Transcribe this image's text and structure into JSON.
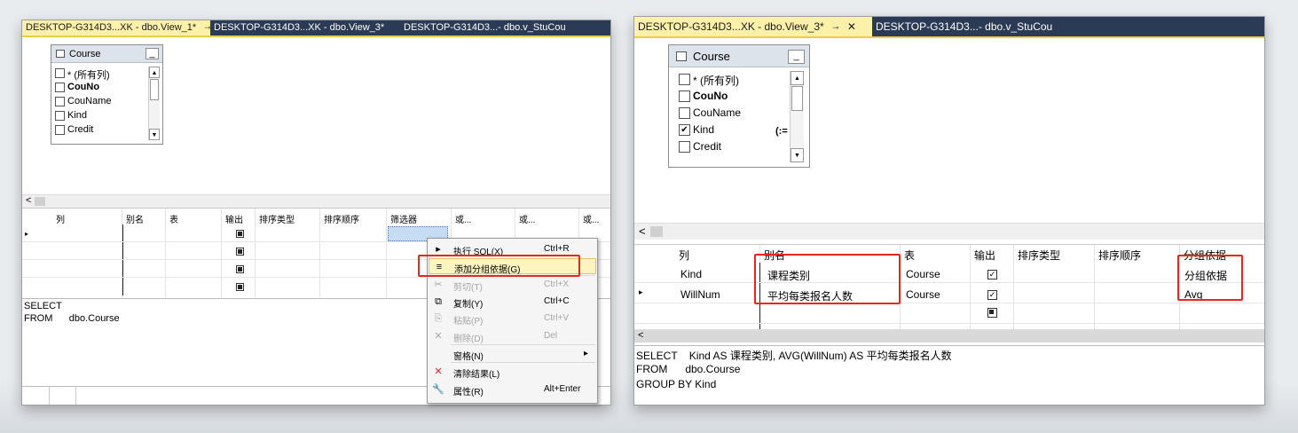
{
  "left": {
    "tabs": [
      {
        "label": "DESKTOP-G314D3...XK - dbo.View_1*",
        "active": true
      },
      {
        "label": "DESKTOP-G314D3...XK - dbo.View_3*",
        "active": false
      },
      {
        "label": "DESKTOP-G314D3...- dbo.v_StuCou",
        "active": false
      }
    ],
    "table_box": {
      "name": "Course",
      "min": "_",
      "columns": [
        {
          "label": "* (所有列)",
          "checked": false,
          "bold": false
        },
        {
          "label": "CouNo",
          "checked": false,
          "bold": true
        },
        {
          "label": "CouName",
          "checked": false,
          "bold": false
        },
        {
          "label": "Kind",
          "checked": false,
          "bold": false
        },
        {
          "label": "Credit",
          "checked": false,
          "bold": false
        }
      ]
    },
    "hscroll_arrow": "<",
    "grid_headers": [
      "列",
      "别名",
      "表",
      "输出",
      "排序类型",
      "排序顺序",
      "筛选器",
      "或...",
      "或...",
      "或..."
    ],
    "sql_lines": [
      "SELECT",
      "FROM      dbo.Course"
    ],
    "context_menu": [
      {
        "icon": "run-sql-icon",
        "glyph": "▸",
        "label": "执行 SQL(X)",
        "shortcut": "Ctrl+R",
        "disabled": false,
        "highlight": false
      },
      {
        "icon": "group-by-icon",
        "glyph": "≡",
        "label": "添加分组依据(G)",
        "shortcut": "",
        "disabled": false,
        "highlight": true
      },
      {
        "icon": "cut-icon",
        "glyph": "✂",
        "label": "剪切(T)",
        "shortcut": "Ctrl+X",
        "disabled": true,
        "highlight": false
      },
      {
        "icon": "copy-icon",
        "glyph": "⧉",
        "label": "复制(Y)",
        "shortcut": "Ctrl+C",
        "disabled": false,
        "highlight": false
      },
      {
        "icon": "paste-icon",
        "glyph": "⎘",
        "label": "粘贴(P)",
        "shortcut": "Ctrl+V",
        "disabled": true,
        "highlight": false
      },
      {
        "icon": "delete-icon",
        "glyph": "✕",
        "label": "删除(D)",
        "shortcut": "Del",
        "disabled": true,
        "highlight": false
      },
      {
        "icon": "pane-icon",
        "glyph": "",
        "label": "窗格(N)",
        "shortcut": "▸",
        "disabled": false,
        "highlight": false
      },
      {
        "icon": "clear-results-icon",
        "glyph": "✕",
        "label": "清除结果(L)",
        "shortcut": "",
        "disabled": false,
        "highlight": false
      },
      {
        "icon": "properties-icon",
        "glyph": "🔧",
        "label": "属性(R)",
        "shortcut": "Alt+Enter",
        "disabled": false,
        "highlight": false
      }
    ]
  },
  "right": {
    "tabs": [
      {
        "label": "DESKTOP-G314D3...XK - dbo.View_3*",
        "active": true
      },
      {
        "label": "DESKTOP-G314D3...- dbo.v_StuCou",
        "active": false
      }
    ],
    "table_box": {
      "name": "Course",
      "min": "_",
      "group_marker": "(:=",
      "columns": [
        {
          "label": "* (所有列)",
          "checked": false,
          "bold": false
        },
        {
          "label": "CouNo",
          "checked": false,
          "bold": true
        },
        {
          "label": "CouName",
          "checked": false,
          "bold": false
        },
        {
          "label": "Kind",
          "checked": true,
          "bold": false
        },
        {
          "label": "Credit",
          "checked": false,
          "bold": false
        }
      ]
    },
    "hscroll_arrow": "<",
    "grid_headers": [
      "列",
      "别名",
      "表",
      "输出",
      "排序类型",
      "排序顺序",
      "分组依据"
    ],
    "grid_rows": [
      {
        "col": "Kind",
        "alias": "课程类别",
        "table": "Course",
        "output": true,
        "group": "分组依据"
      },
      {
        "col": "WillNum",
        "alias": "平均每类报名人数",
        "table": "Course",
        "output": true,
        "group": "Avg"
      }
    ],
    "sql_lines": [
      "SELECT    Kind AS 课程类别, AVG(WillNum) AS 平均每类报名人数",
      "FROM      dbo.Course",
      "GROUP BY Kind"
    ]
  }
}
